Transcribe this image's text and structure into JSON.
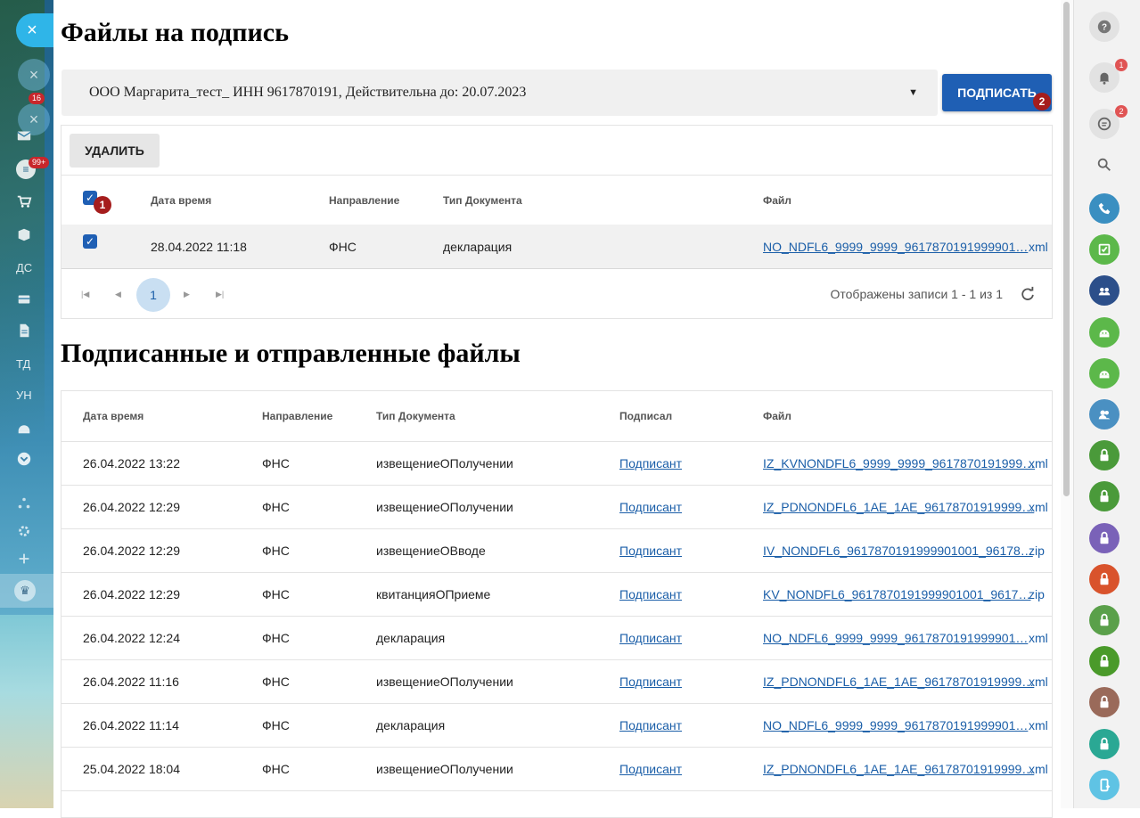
{
  "left_nav": {
    "close_glyph": "×",
    "badges": [
      "16",
      "99+"
    ],
    "labels": [
      "ДС",
      "ТД",
      "УН"
    ],
    "items": [
      {
        "icon": "mail-icon"
      },
      {
        "icon": "filter-icon"
      },
      {
        "icon": "cart-icon"
      },
      {
        "icon": "box-icon"
      },
      {
        "icon": "storage-icon"
      },
      {
        "icon": "document-icon"
      },
      {
        "icon": "android-icon"
      },
      {
        "icon": "chevron-down-icon"
      },
      {
        "icon": "tree-icon"
      },
      {
        "icon": "gear-icon"
      },
      {
        "icon": "plus-icon"
      },
      {
        "icon": "crown-icon"
      }
    ]
  },
  "pending": {
    "title": "Файлы на подпись",
    "signer_value": "ООО Маргарита_тест_ ИНН 9617870191, Действительна до: 20.07.2023",
    "sign_label": "ПОДПИСАТЬ",
    "sign_badge": "2",
    "delete_label": "УДАЛИТЬ",
    "select_all_badge": "1",
    "columns": [
      "Дата время",
      "Направление",
      "Тип Документа",
      "Файл"
    ],
    "rows": [
      {
        "date": "28.04.2022 11:18",
        "direction": "ФНС",
        "type": "декларация",
        "file": "NO_NDFL6_9999_9999_9617870191999901…",
        "ext": "xml",
        "checked": true
      }
    ],
    "pager": {
      "current_page": "1",
      "info": "Отображены записи 1 - 1 из 1"
    }
  },
  "signed": {
    "title": "Подписанные и отправленные файлы",
    "columns": [
      "Дата время",
      "Направление",
      "Тип Документа",
      "Подписал",
      "Файл"
    ],
    "rows": [
      {
        "date": "26.04.2022 13:22",
        "direction": "ФНС",
        "type": "извещениеОПолучении",
        "signer": "Подписант",
        "file": "IZ_KVNONDFL6_9999_9999_9617870191999…",
        "ext": "xml"
      },
      {
        "date": "26.04.2022 12:29",
        "direction": "ФНС",
        "type": "извещениеОПолучении",
        "signer": "Подписант",
        "file": "IZ_PDNONDFL6_1AE_1AE_96178701919999…",
        "ext": "xml"
      },
      {
        "date": "26.04.2022 12:29",
        "direction": "ФНС",
        "type": "извещениеОВводе",
        "signer": "Подписант",
        "file": "IV_NONDFL6_9617870191999901001_96178…",
        "ext": "zip"
      },
      {
        "date": "26.04.2022 12:29",
        "direction": "ФНС",
        "type": "квитанцияОПриеме",
        "signer": "Подписант",
        "file": "KV_NONDFL6_9617870191999901001_9617…",
        "ext": "zip"
      },
      {
        "date": "26.04.2022 12:24",
        "direction": "ФНС",
        "type": "декларация",
        "signer": "Подписант",
        "file": "NO_NDFL6_9999_9999_9617870191999901…",
        "ext": "xml"
      },
      {
        "date": "26.04.2022 11:16",
        "direction": "ФНС",
        "type": "извещениеОПолучении",
        "signer": "Подписант",
        "file": "IZ_PDNONDFL6_1AE_1AE_96178701919999…",
        "ext": "xml"
      },
      {
        "date": "26.04.2022 11:14",
        "direction": "ФНС",
        "type": "декларация",
        "signer": "Подписант",
        "file": "NO_NDFL6_9999_9999_9617870191999901…",
        "ext": "xml"
      },
      {
        "date": "25.04.2022 18:04",
        "direction": "ФНС",
        "type": "извещениеОПолучении",
        "signer": "Подписант",
        "file": "IZ_PDNONDFL6_1AE_1AE_96178701919999…",
        "ext": "xml"
      }
    ]
  },
  "right_bar": {
    "notification_badge": "1",
    "chat_badge": "2",
    "apps": [
      {
        "icon": "phone-icon",
        "color": "#3a8fc1"
      },
      {
        "icon": "task-check-icon",
        "color": "#5cb84a"
      },
      {
        "icon": "group-chat-icon",
        "color": "#2c4f8a"
      },
      {
        "icon": "android-app-icon",
        "color": "#5cb84a"
      },
      {
        "icon": "android-app-icon",
        "color": "#5cb84a"
      },
      {
        "icon": "contacts-icon",
        "color": "#4a90c2"
      },
      {
        "icon": "lock-icon",
        "color": "#4a9a3a"
      },
      {
        "icon": "lock-icon",
        "color": "#4a9a3a"
      },
      {
        "icon": "lock-icon",
        "color": "#7a62b8"
      },
      {
        "icon": "lock-icon",
        "color": "#d9532c"
      },
      {
        "icon": "lock-icon",
        "color": "#5aa04a"
      },
      {
        "icon": "lock-icon",
        "color": "#4a9a2a"
      },
      {
        "icon": "lock-icon",
        "color": "#9a6a5a"
      },
      {
        "icon": "lock-icon",
        "color": "#2aa894"
      },
      {
        "icon": "mobile-icon",
        "color": "#5fc3e4"
      }
    ]
  }
}
